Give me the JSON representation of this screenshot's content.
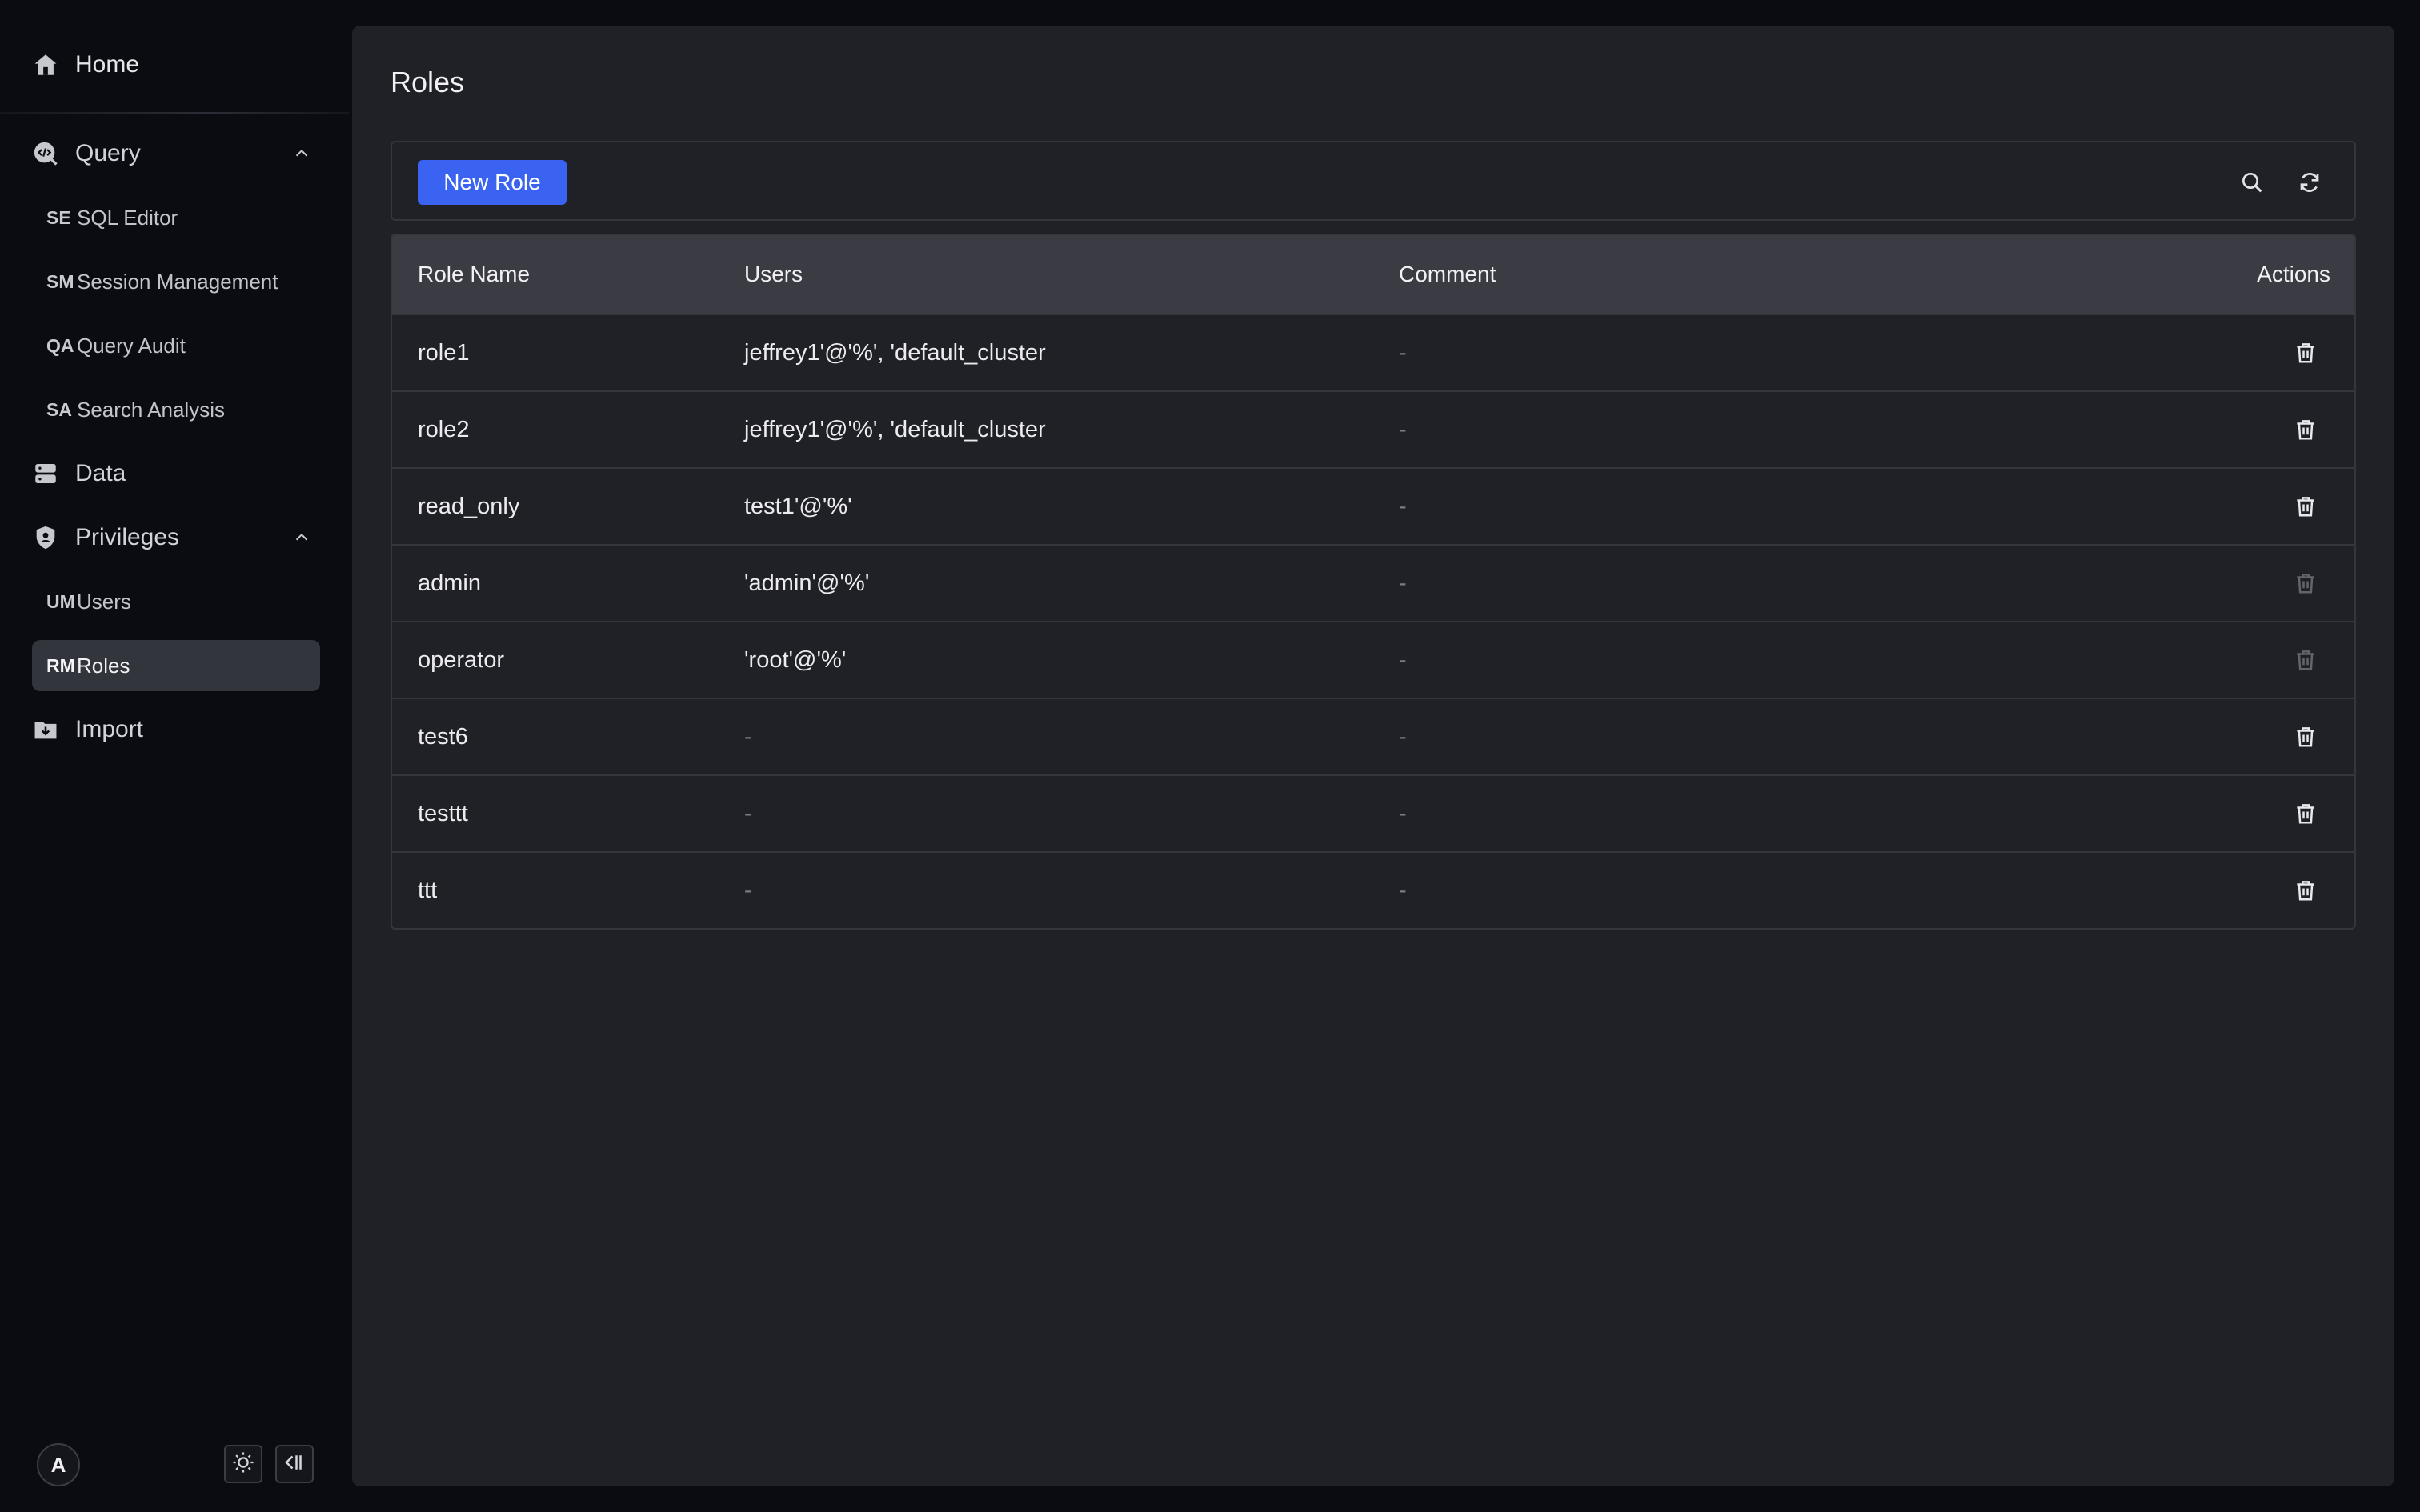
{
  "sidebar": {
    "home_label": "Home",
    "groups": {
      "query": "Query",
      "data": "Data",
      "privileges": "Privileges",
      "import": "Import"
    },
    "items": [
      {
        "abbr": "SE",
        "label": "SQL Editor"
      },
      {
        "abbr": "SM",
        "label": "Session Management"
      },
      {
        "abbr": "QA",
        "label": "Query Audit"
      },
      {
        "abbr": "SA",
        "label": "Search Analysis"
      },
      {
        "abbr": "UM",
        "label": "Users"
      },
      {
        "abbr": "RM",
        "label": "Roles",
        "active": true
      }
    ],
    "avatar_initial": "A",
    "footer_icons": [
      "sun-icon",
      "collapse-sidebar-icon"
    ]
  },
  "page": {
    "title": "Roles",
    "new_button_label": "New Role",
    "toolbar_icons": [
      "search-icon",
      "refresh-icon"
    ]
  },
  "table": {
    "headers": [
      "Role Name",
      "Users",
      "Comment",
      "Actions"
    ],
    "rows": [
      {
        "name": "role1",
        "users": "jeffrey1'@'%', 'default_cluster",
        "comment": "-",
        "delete_enabled": true
      },
      {
        "name": "role2",
        "users": "jeffrey1'@'%', 'default_cluster",
        "comment": "-",
        "delete_enabled": true
      },
      {
        "name": "read_only",
        "users": "test1'@'%'",
        "comment": "-",
        "delete_enabled": true
      },
      {
        "name": "admin",
        "users": "'admin'@'%'",
        "comment": "-",
        "delete_enabled": false
      },
      {
        "name": "operator",
        "users": "'root'@'%'",
        "comment": "-",
        "delete_enabled": false
      },
      {
        "name": "test6",
        "users": "-",
        "comment": "-",
        "delete_enabled": true
      },
      {
        "name": "testtt",
        "users": "-",
        "comment": "-",
        "delete_enabled": true
      },
      {
        "name": "ttt",
        "users": "-",
        "comment": "-",
        "delete_enabled": true
      }
    ]
  },
  "colors": {
    "accent": "#3b63f2",
    "panel": "#202127",
    "sidebar": "#0b0c12",
    "header_row": "#3a3b43"
  }
}
